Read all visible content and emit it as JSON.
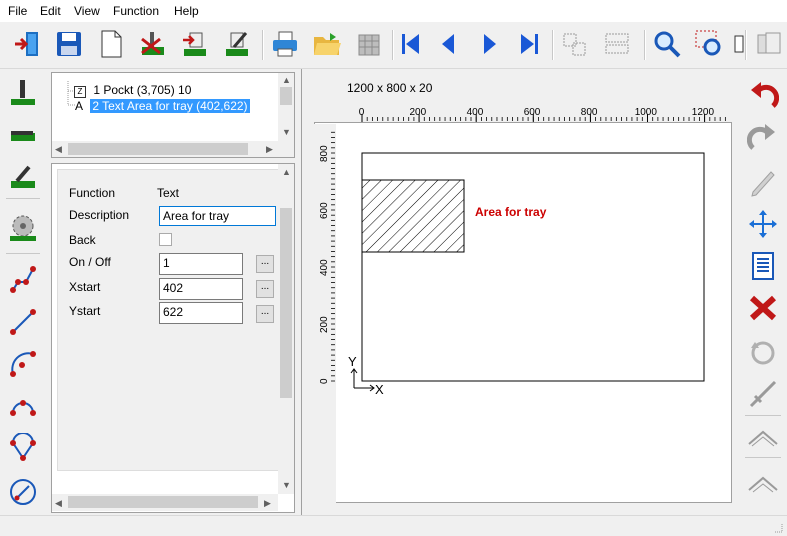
{
  "menu": {
    "file": "File",
    "edit": "Edit",
    "view": "View",
    "function": "Function",
    "help": "Help"
  },
  "tree": {
    "items": [
      {
        "icon": "Z",
        "label": "1 Pockt  (3,705) 10"
      },
      {
        "icon": "A",
        "label": "2 Text Area for tray (402,622)"
      }
    ]
  },
  "properties": {
    "function_label": "Function",
    "function_value": "Text",
    "description_label": "Description",
    "description_value": "Area for tray",
    "back_label": "Back",
    "onoff_label": "On / Off",
    "onoff_value": "1",
    "xstart_label": "Xstart",
    "xstart_value": "402",
    "ystart_label": "Ystart",
    "ystart_value": "622",
    "more_button": "..."
  },
  "canvas": {
    "size_label": "1200 x 800 x 20",
    "x_ticks": [
      "0",
      "200",
      "400",
      "600",
      "800",
      "1000",
      "1200"
    ],
    "y_ticks": [
      "0",
      "200",
      "400",
      "600",
      "800"
    ],
    "text_annotation": "Area for tray",
    "axis_x": "X",
    "axis_y": "Y",
    "accent_red": "#cc0000"
  }
}
